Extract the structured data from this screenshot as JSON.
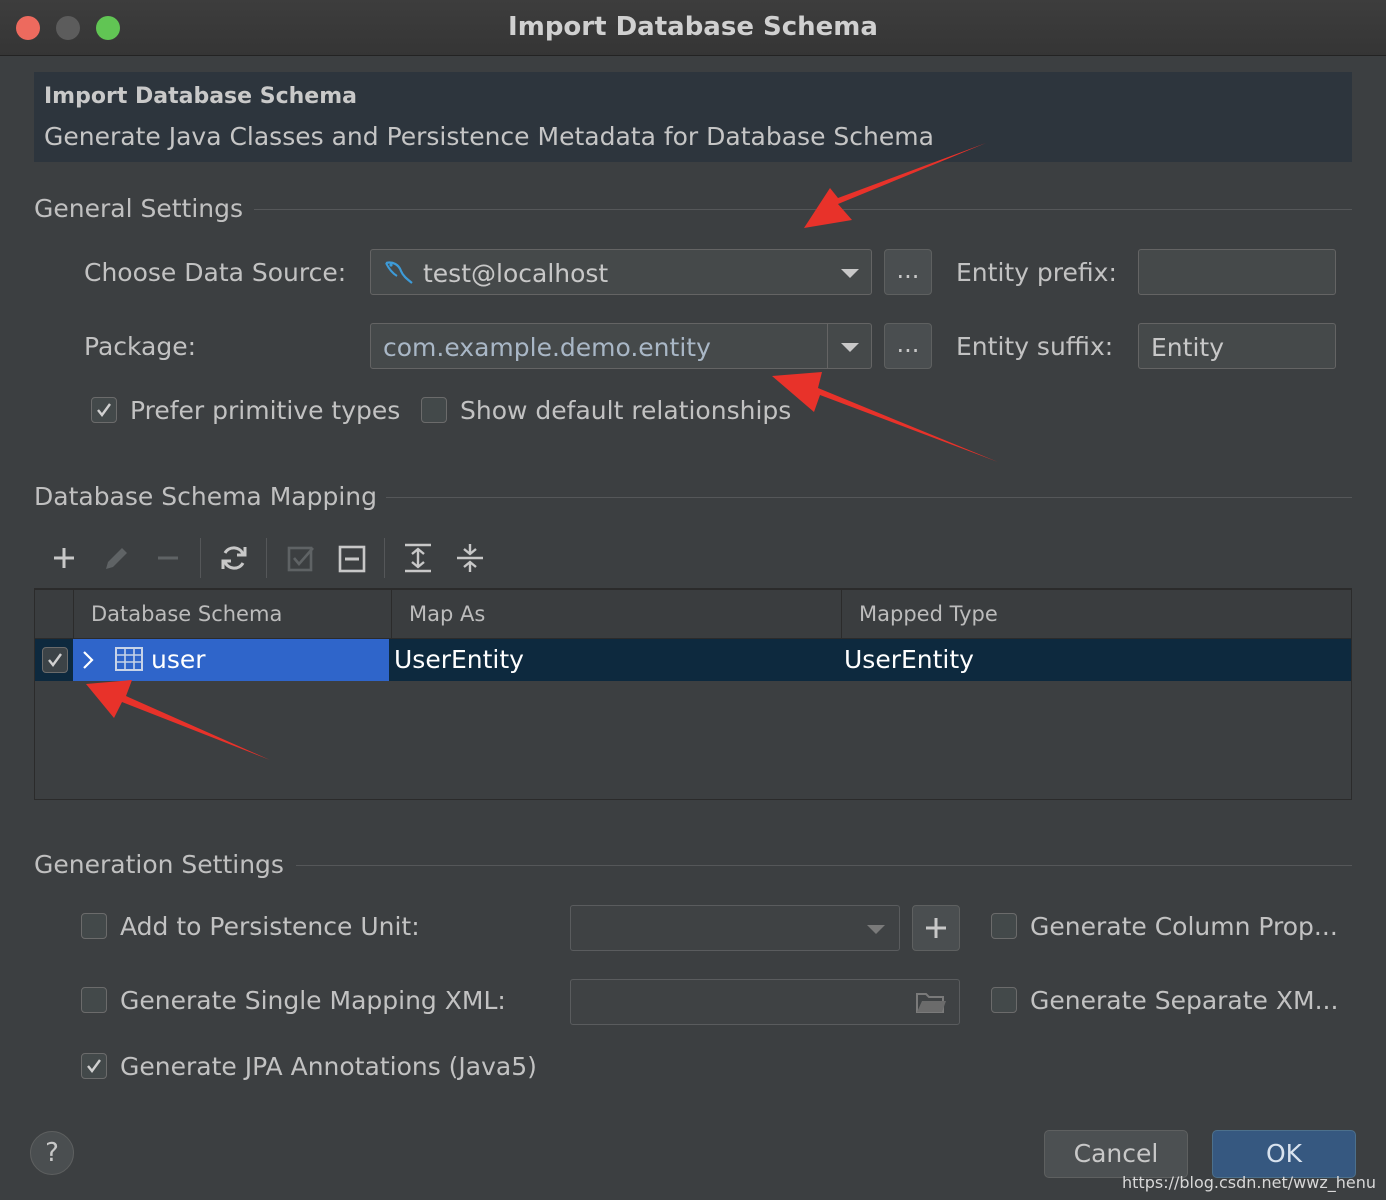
{
  "window": {
    "title": "Import Database Schema"
  },
  "banner": {
    "title": "Import Database Schema",
    "description": "Generate Java Classes and Persistence Metadata for Database Schema"
  },
  "general": {
    "section": "General Settings",
    "data_source_label": "Choose Data Source:",
    "data_source_value": "test@localhost",
    "package_label": "Package:",
    "package_value": "com.example.demo.entity",
    "browse": "...",
    "entity_prefix_label": "Entity prefix:",
    "entity_prefix_value": "",
    "entity_suffix_label": "Entity suffix:",
    "entity_suffix_value": "Entity",
    "prefer_primitive": {
      "label": "Prefer primitive types",
      "checked": true
    },
    "show_relationships": {
      "label": "Show default relationships",
      "checked": false
    }
  },
  "mapping": {
    "section": "Database Schema Mapping",
    "columns": [
      "Database Schema",
      "Map As",
      "Mapped Type"
    ],
    "rows": [
      {
        "checked": true,
        "schema": "user",
        "map_as": "UserEntity",
        "mapped_type": "UserEntity"
      }
    ]
  },
  "generation": {
    "section": "Generation Settings",
    "persistence_unit": {
      "label": "Add to Persistence Unit:",
      "checked": false,
      "value": ""
    },
    "single_xml": {
      "label": "Generate Single Mapping XML:",
      "checked": false,
      "value": ""
    },
    "jpa_annotations": {
      "label": "Generate JPA Annotations (Java5)",
      "checked": true
    },
    "column_props": {
      "label": "Generate Column Prop...",
      "checked": false
    },
    "separate_xml": {
      "label": "Generate Separate XM...",
      "checked": false
    }
  },
  "footer": {
    "help": "?",
    "cancel": "Cancel",
    "ok": "OK"
  },
  "watermark": "https://blog.csdn.net/wwz_henu",
  "colors": {
    "accent": "#2f65ca",
    "selected_row": "#0d293e",
    "annotation_arrow": "#e8322a"
  }
}
